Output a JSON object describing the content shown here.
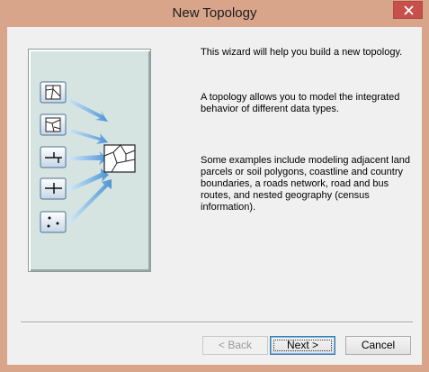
{
  "window": {
    "title": "New Topology"
  },
  "titlebar": {
    "close_icon": "close-icon"
  },
  "illustration": {
    "icons": [
      "polygon-icon",
      "polygon-icon",
      "line-icon",
      "line-icon",
      "points-icon"
    ],
    "target_icon": "topology-icon",
    "arrow_color": "#5aa0d8"
  },
  "description": {
    "paragraph1": "This wizard will help you build a new topology.",
    "paragraph2": "A topology allows you to model the integrated behavior of different data types.",
    "paragraph3": "Some examples include modeling adjacent land parcels or soil polygons, coastline and country boundaries, a roads network, road and bus routes, and nested geography (census information)."
  },
  "buttons": {
    "back": {
      "label": "< Back",
      "enabled": false
    },
    "next": {
      "label": "Next >",
      "enabled": true
    },
    "cancel": {
      "label": "Cancel",
      "enabled": true
    }
  }
}
